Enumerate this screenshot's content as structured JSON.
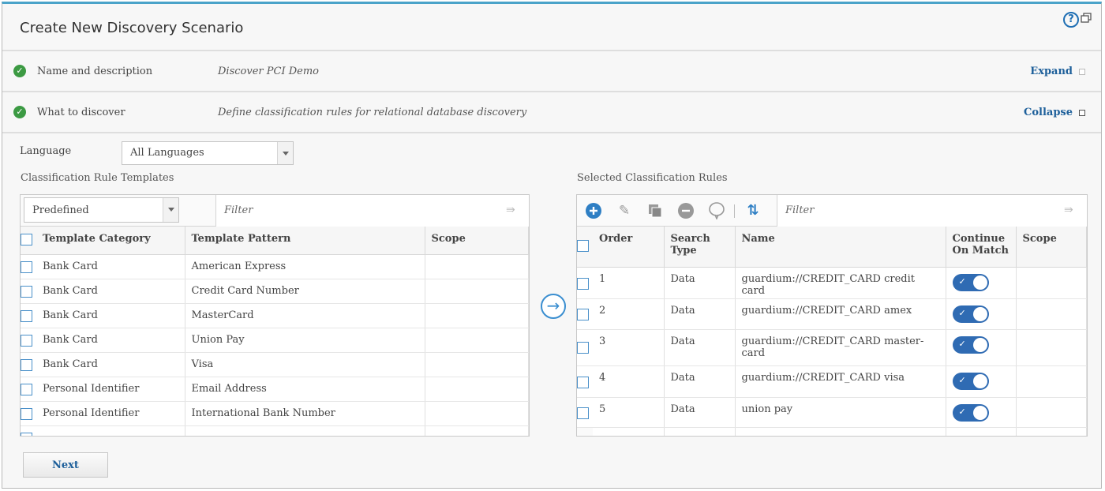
{
  "header": {
    "title": "Create New Discovery Scenario",
    "help_icon": "help-circle-icon",
    "restore_icon": "window-restore-icon"
  },
  "steps": [
    {
      "label": "Name and description",
      "description": "Discover PCI Demo",
      "action": "Expand",
      "status_icon": "check-circle-icon"
    },
    {
      "label": "What to discover",
      "description": "Define classification rules for relational database discovery",
      "action": "Collapse",
      "status_icon": "check-circle-icon"
    }
  ],
  "language": {
    "label": "Language",
    "selected": "All Languages"
  },
  "templates": {
    "section_label": "Classification Rule Templates",
    "source_select": "Predefined",
    "filter_placeholder": "Filter",
    "columns": [
      "Template Category",
      "Template Pattern",
      "Scope"
    ],
    "rows": [
      {
        "category": "Bank Card",
        "pattern": "American Express",
        "scope": ""
      },
      {
        "category": "Bank Card",
        "pattern": "Credit Card Number",
        "scope": ""
      },
      {
        "category": "Bank Card",
        "pattern": "MasterCard",
        "scope": ""
      },
      {
        "category": "Bank Card",
        "pattern": "Union Pay",
        "scope": ""
      },
      {
        "category": "Bank Card",
        "pattern": "Visa",
        "scope": ""
      },
      {
        "category": "Personal Identifier",
        "pattern": "Email Address",
        "scope": ""
      },
      {
        "category": "Personal Identifier",
        "pattern": "International Bank Number",
        "scope": ""
      }
    ]
  },
  "selected_rules": {
    "section_label": "Selected Classification Rules",
    "filter_placeholder": "Filter",
    "toolbar_icons": [
      "add-icon",
      "edit-icon",
      "copy-icon",
      "remove-icon",
      "comment-icon",
      "reorder-icon"
    ],
    "columns": {
      "order": "Order",
      "search_type_1": "Search",
      "search_type_2": "Type",
      "name": "Name",
      "continue_1": "Continue",
      "continue_2": "On Match",
      "scope": "Scope"
    },
    "rows": [
      {
        "order": "1",
        "type": "Data",
        "name": "guardium://CREDIT_CARD credit card",
        "continue_on_match": true,
        "scope": ""
      },
      {
        "order": "2",
        "type": "Data",
        "name": "guardium://CREDIT_CARD amex",
        "continue_on_match": true,
        "scope": ""
      },
      {
        "order": "3",
        "type": "Data",
        "name": "guardium://CREDIT_CARD master-card",
        "continue_on_match": true,
        "scope": ""
      },
      {
        "order": "4",
        "type": "Data",
        "name": "guardium://CREDIT_CARD visa",
        "continue_on_match": true,
        "scope": ""
      },
      {
        "order": "5",
        "type": "Data",
        "name": "union pay",
        "continue_on_match": true,
        "scope": ""
      }
    ]
  },
  "buttons": {
    "next": "Next"
  },
  "colors": {
    "accent": "#1d5f9a",
    "toggle_on": "#2f6bb3",
    "check": "#3c9a43",
    "top_border": "#4aa3c9"
  }
}
